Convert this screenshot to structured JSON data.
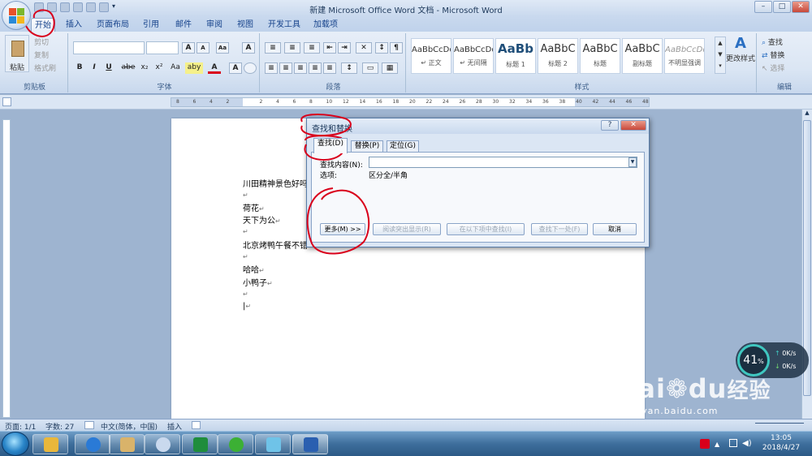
{
  "window": {
    "title": "新建 Microsoft Office Word 文档 - Microsoft Word",
    "min": "–",
    "max": "□",
    "close": "✕"
  },
  "tabs": [
    "开始",
    "插入",
    "页面布局",
    "引用",
    "邮件",
    "审阅",
    "视图",
    "开发工具",
    "加载项"
  ],
  "ribbon": {
    "clipboard": {
      "label": "剪贴板",
      "paste": "粘贴",
      "cut": "剪切",
      "copy": "复制",
      "format_painter": "格式刷"
    },
    "font": {
      "label": "字体",
      "bold": "B",
      "italic": "I",
      "underline": "U",
      "strike": "abe",
      "sub": "x₂",
      "sup": "x²",
      "clear": "Aa",
      "font_color": "A",
      "highlight": "aby",
      "grow": "A",
      "shrink": "A",
      "char_border": "A"
    },
    "paragraph": {
      "label": "段落"
    },
    "styles": {
      "label": "样式",
      "items": [
        {
          "preview": "AaBbCcDd",
          "name": "↵ 正文"
        },
        {
          "preview": "AaBbCcDd",
          "name": "↵ 无间隔"
        },
        {
          "preview": "AaBb",
          "name": "标题 1"
        },
        {
          "preview": "AaBbC",
          "name": "标题 2"
        },
        {
          "preview": "AaBbC",
          "name": "标题"
        },
        {
          "preview": "AaBbC",
          "name": "副标题"
        },
        {
          "preview": "AaBbCcDd",
          "name": "不明显强调"
        }
      ],
      "change_styles": "更改样式"
    },
    "editing": {
      "label": "编辑",
      "find": "查找",
      "replace": "替换",
      "select": "选择"
    }
  },
  "ruler": {
    "ticks": [
      "8",
      "6",
      "4",
      "2",
      "",
      "2",
      "4",
      "6",
      "8",
      "10",
      "12",
      "14",
      "16",
      "18",
      "20",
      "22",
      "24",
      "26",
      "28",
      "30",
      "32",
      "34",
      "36",
      "38",
      "40",
      "42",
      "44",
      "46",
      "48"
    ]
  },
  "document": {
    "lines": [
      "川田精神景色好吗",
      "荷花",
      "天下为公",
      "北京烤鸭午餐不错",
      "哈哈",
      "小鸭子"
    ]
  },
  "dialog": {
    "title": "查找和替换",
    "help": "?",
    "close": "✕",
    "tabs": [
      "查找(D)",
      "替换(P)",
      "定位(G)"
    ],
    "find_label": "查找内容(N):",
    "find_value": "",
    "options_label": "选项:",
    "options_value": "区分全/半角",
    "buttons": {
      "more": "更多(M) >>",
      "highlight": "阅读突出显示(R)",
      "find_in": "在以下项中查找(I)",
      "find_next": "查找下一处(F)",
      "cancel": "取消"
    }
  },
  "statusbar": {
    "page": "页面: 1/1",
    "words": "字数: 27",
    "lang": "中文(简体，中国)",
    "mode": "插入"
  },
  "network": {
    "percent": "41",
    "unit": "%",
    "up": "0K/s",
    "down": "0K/s"
  },
  "watermark": {
    "text": "Bai",
    "text2": "du",
    "cn": "经验",
    "url": "jingyan.baidu.com"
  },
  "clock": {
    "time": "13:05",
    "date": "2018/4/27"
  },
  "colors": {
    "accent": "#dbe6f4",
    "annotation": "#d9001b",
    "title": "#1e395b"
  }
}
